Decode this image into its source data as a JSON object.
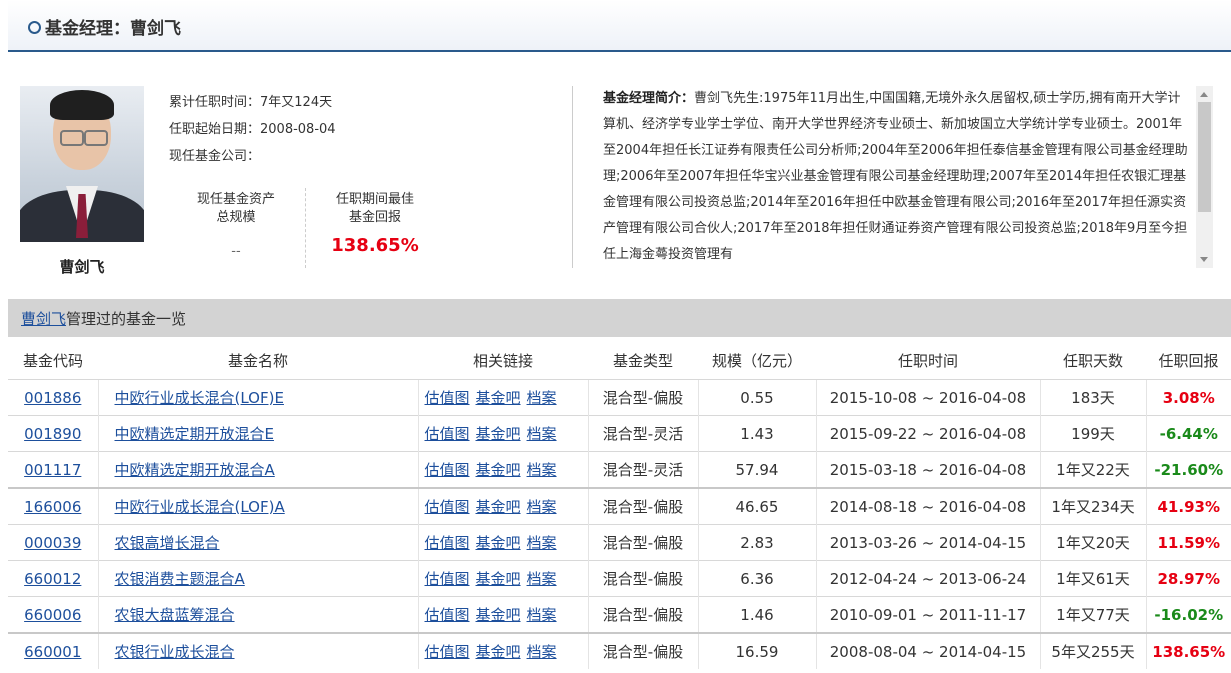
{
  "header": {
    "title": "基金经理：曹剑飞"
  },
  "profile": {
    "name": "曹剑飞",
    "tenure": "累计任职时间：7年又124天",
    "start_date": "任职起始日期：2008-08-04",
    "company": "现任基金公司：",
    "asset_label_1": "现任基金资产",
    "asset_label_2": "总规模",
    "asset_value": "--",
    "return_label_1": "任职期间最佳",
    "return_label_2": "基金回报",
    "return_value": "138.65%"
  },
  "bio": {
    "label": "基金经理简介：",
    "text": "曹剑飞先生:1975年11月出生,中国国籍,无境外永久居留权,硕士学历,拥有南开大学计算机、经济学专业学士学位、南开大学世界经济专业硕士、新加坡国立大学统计学专业硕士。2001年至2004年担任长江证券有限责任公司分析师;2004年至2006年担任泰信基金管理有限公司基金经理助理;2006年至2007年担任华宝兴业基金管理有限公司基金经理助理;2007年至2014年担任农银汇理基金管理有限公司投资总监;2014年至2016年担任中欧基金管理有限公司;2016年至2017年担任源实资产管理有限公司合伙人;2017年至2018年担任财通证券资产管理有限公司投资总监;2018年9月至今担任上海金蕚投资管理有"
  },
  "section": {
    "name_link": "曹剑飞",
    "suffix": "管理过的基金一览"
  },
  "table": {
    "headers": [
      "基金代码",
      "基金名称",
      "相关链接",
      "基金类型",
      "规模（亿元）",
      "任职时间",
      "任职天数",
      "任职回报"
    ],
    "link_labels": [
      "估值图",
      "基金吧",
      "档案"
    ],
    "rows": [
      {
        "code": "001886",
        "name": "中欧行业成长混合(LOF)E",
        "type": "混合型-偏股",
        "size": "0.55",
        "period": "2015-10-08 ~ 2016-04-08",
        "days": "183天",
        "ret": "3.08%",
        "sign": "pos"
      },
      {
        "code": "001890",
        "name": "中欧精选定期开放混合E",
        "type": "混合型-灵活",
        "size": "1.43",
        "period": "2015-09-22 ~ 2016-04-08",
        "days": "199天",
        "ret": "-6.44%",
        "sign": "neg"
      },
      {
        "code": "001117",
        "name": "中欧精选定期开放混合A",
        "type": "混合型-灵活",
        "size": "57.94",
        "period": "2015-03-18 ~ 2016-04-08",
        "days": "1年又22天",
        "ret": "-21.60%",
        "sign": "neg"
      },
      {
        "code": "166006",
        "name": "中欧行业成长混合(LOF)A",
        "type": "混合型-偏股",
        "size": "46.65",
        "period": "2014-08-18 ~ 2016-04-08",
        "days": "1年又234天",
        "ret": "41.93%",
        "sign": "pos"
      },
      {
        "code": "000039",
        "name": "农银高增长混合",
        "type": "混合型-偏股",
        "size": "2.83",
        "period": "2013-03-26 ~ 2014-04-15",
        "days": "1年又20天",
        "ret": "11.59%",
        "sign": "pos"
      },
      {
        "code": "660012",
        "name": "农银消费主题混合A",
        "type": "混合型-偏股",
        "size": "6.36",
        "period": "2012-04-24 ~ 2013-06-24",
        "days": "1年又61天",
        "ret": "28.97%",
        "sign": "pos"
      },
      {
        "code": "660006",
        "name": "农银大盘蓝筹混合",
        "type": "混合型-偏股",
        "size": "1.46",
        "period": "2010-09-01 ~ 2011-11-17",
        "days": "1年又77天",
        "ret": "-16.02%",
        "sign": "neg"
      },
      {
        "code": "660001",
        "name": "农银行业成长混合",
        "type": "混合型-偏股",
        "size": "16.59",
        "period": "2008-08-04 ~ 2014-04-15",
        "days": "5年又255天",
        "ret": "138.65%",
        "sign": "pos"
      }
    ]
  }
}
